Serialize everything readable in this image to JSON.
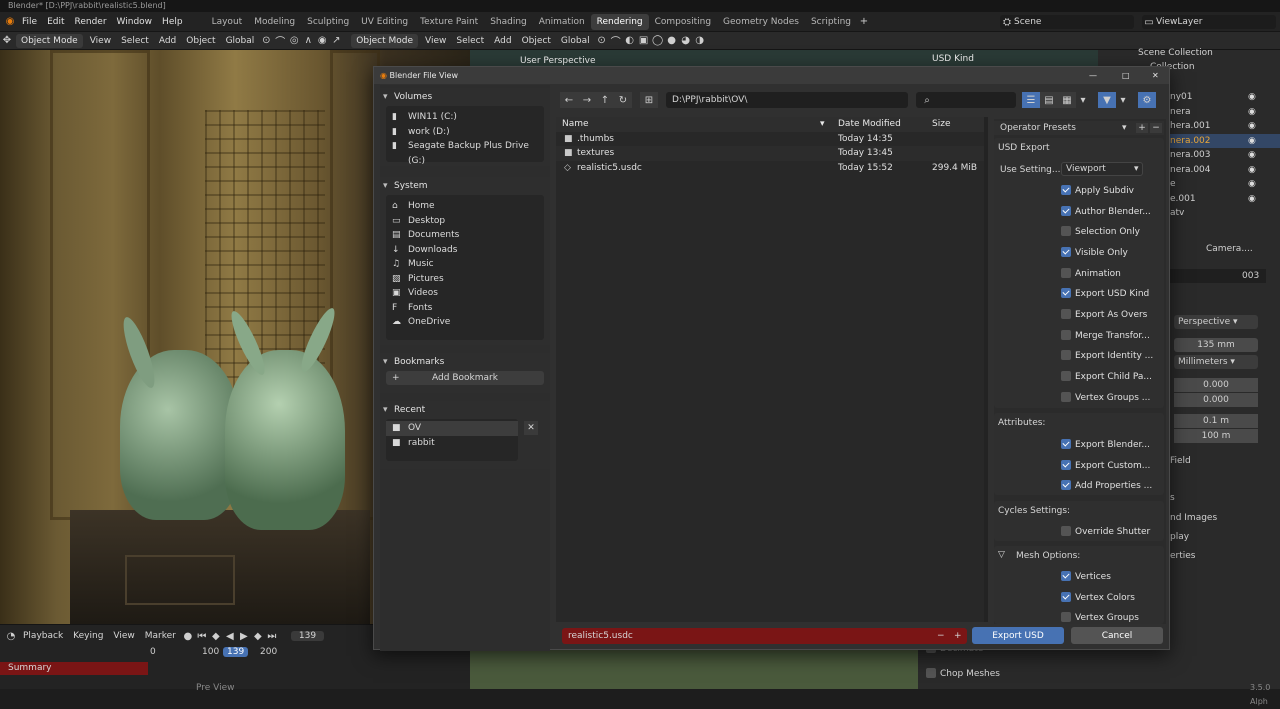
{
  "window_title": "Blender* [D:\\PPJ\\rabbit\\realistic5.blend]",
  "menus": [
    "File",
    "Edit",
    "Render",
    "Window",
    "Help"
  ],
  "workspaces": [
    "Layout",
    "Modeling",
    "Sculpting",
    "UV Editing",
    "Texture Paint",
    "Shading",
    "Animation",
    "Rendering",
    "Compositing",
    "Geometry Nodes",
    "Scripting"
  ],
  "active_workspace": "Rendering",
  "scene_name": "Scene",
  "view_layer": "ViewLayer",
  "toolbar": {
    "mode": "Object Mode",
    "view": "View",
    "select": "Select",
    "add": "Add",
    "object": "Object",
    "transform": "Global",
    "mode2": "Object Mode",
    "view2": "View",
    "select2": "Select",
    "add2": "Add",
    "object2": "Object",
    "transform2": "Global"
  },
  "viewport_header": {
    "perspective": "User Perspective",
    "usd_kind": "USD Kind"
  },
  "outliner": {
    "scene_collection": "Scene Collection",
    "collection": "Collection",
    "items": [
      "ny01",
      "nera",
      "hera.001",
      "nera.002",
      "nera.003",
      "nera.004",
      "e",
      "e.001",
      "atv"
    ]
  },
  "properties": {
    "camera_name": "Camera....",
    "camera_data": "003",
    "type": "Perspective",
    "focal_length": "135 mm",
    "lens_unit": "Millimeters",
    "shift_x": "0.000",
    "shift_y": "0.000",
    "clip_start": "0.1 m",
    "clip_end": "100 m",
    "field": "Field",
    "s_label": "s",
    "images": "nd Images",
    "display": "play",
    "erties": "erties",
    "decimate": "Decimate",
    "chop": "Chop Meshes",
    "version": "3.5.0 Alph"
  },
  "timeline": {
    "playback": "Playback",
    "keying": "Keying",
    "view": "View",
    "marker": "Marker",
    "current_frame": "139",
    "ticks": [
      "0",
      "100",
      "139",
      "200"
    ],
    "summary": "Summary",
    "frame_field": "139",
    "preview": "Pre View"
  },
  "dialog": {
    "title": "Blender File View",
    "path": "D:\\PPJ\\rabbit\\OV\\",
    "search_placeholder": "",
    "volumes_title": "Volumes",
    "volumes": [
      "WIN11 (C:)",
      "work (D:)",
      "Seagate Backup Plus Drive (G:)"
    ],
    "system_title": "System",
    "system": [
      {
        "label": "Home",
        "icon": "home-icon",
        "glyph": "⌂"
      },
      {
        "label": "Desktop",
        "icon": "desktop-icon",
        "glyph": "▭"
      },
      {
        "label": "Documents",
        "icon": "documents-icon",
        "glyph": "▤"
      },
      {
        "label": "Downloads",
        "icon": "downloads-icon",
        "glyph": "↓"
      },
      {
        "label": "Music",
        "icon": "music-icon",
        "glyph": "♫"
      },
      {
        "label": "Pictures",
        "icon": "pictures-icon",
        "glyph": "▨"
      },
      {
        "label": "Videos",
        "icon": "videos-icon",
        "glyph": "▣"
      },
      {
        "label": "Fonts",
        "icon": "fonts-icon",
        "glyph": "F"
      },
      {
        "label": "OneDrive",
        "icon": "onedrive-icon",
        "glyph": "☁"
      }
    ],
    "bookmarks_title": "Bookmarks",
    "add_bookmark": "Add Bookmark",
    "recent_title": "Recent",
    "recent": [
      "OV",
      "rabbit"
    ],
    "columns": {
      "name": "Name",
      "date": "Date Modified",
      "size": "Size"
    },
    "files": [
      {
        "name": ".thumbs",
        "date": "Today 14:35",
        "size": "",
        "type": "folder"
      },
      {
        "name": "textures",
        "date": "Today 13:45",
        "size": "",
        "type": "folder"
      },
      {
        "name": "realistic5.usdc",
        "date": "Today 15:52",
        "size": "299.4 MiB",
        "type": "file"
      }
    ],
    "operator_presets": "Operator Presets",
    "usd_export": "USD Export",
    "use_settings_label": "Use Setting...",
    "use_settings_value": "Viewport",
    "options": [
      {
        "label": "Apply Subdiv",
        "checked": true
      },
      {
        "label": "Author Blender...",
        "checked": true
      },
      {
        "label": "Selection Only",
        "checked": false
      },
      {
        "label": "Visible Only",
        "checked": true
      },
      {
        "label": "Animation",
        "checked": false
      },
      {
        "label": "Export USD Kind",
        "checked": true
      },
      {
        "label": "Export As Overs",
        "checked": false
      },
      {
        "label": "Merge Transfor...",
        "checked": false
      },
      {
        "label": "Export Identity ...",
        "checked": false
      },
      {
        "label": "Export Child Pa...",
        "checked": false
      },
      {
        "label": "Vertex Groups ...",
        "checked": false
      }
    ],
    "attributes_title": "Attributes:",
    "attributes": [
      {
        "label": "Export Blender...",
        "checked": true
      },
      {
        "label": "Export Custom...",
        "checked": true
      },
      {
        "label": "Add Properties ...",
        "checked": true
      }
    ],
    "cycles_title": "Cycles Settings:",
    "cycles": [
      {
        "label": "Override Shutter",
        "checked": false
      }
    ],
    "mesh_title": "Mesh Options:",
    "mesh": [
      {
        "label": "Vertices",
        "checked": true
      },
      {
        "label": "Vertex Colors",
        "checked": true
      },
      {
        "label": "Vertex Groups",
        "checked": false
      }
    ],
    "filename": "realistic5.usdc",
    "export_button": "Export USD",
    "cancel_button": "Cancel"
  },
  "colors": {
    "accent": "#4772b3",
    "filename_bg": "#7a1515",
    "export_bg": "#4772b3"
  }
}
